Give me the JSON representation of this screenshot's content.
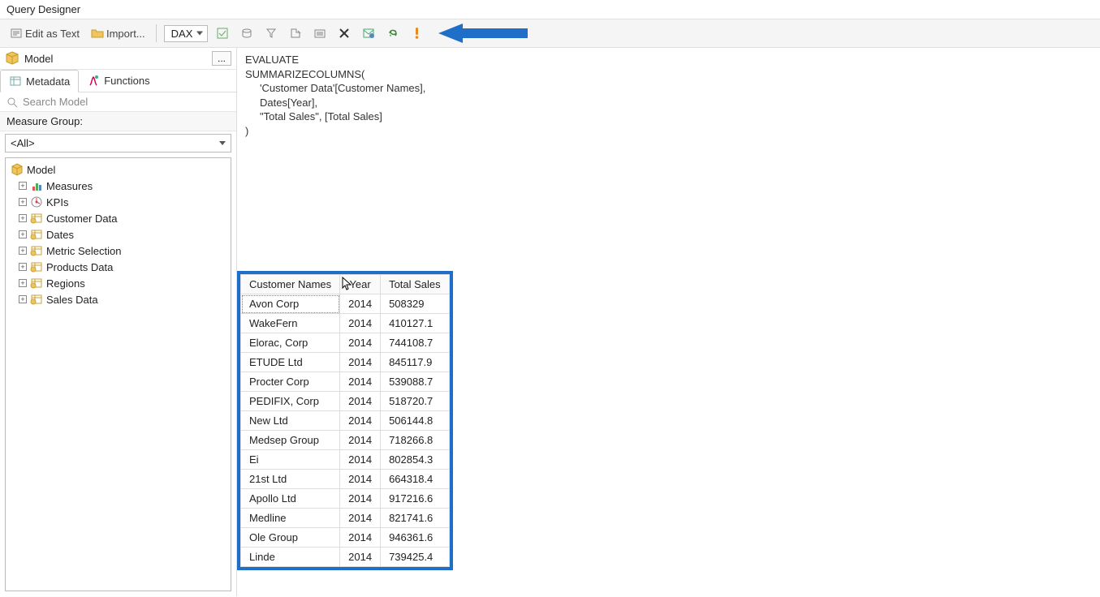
{
  "window": {
    "title": "Query Designer"
  },
  "toolbar": {
    "edit_as_text": "Edit as Text",
    "import": "Import...",
    "language": "DAX"
  },
  "sidebar": {
    "model_label": "Model",
    "ellipsis": "...",
    "tabs": {
      "metadata": "Metadata",
      "functions": "Functions"
    },
    "search_placeholder": "Search Model",
    "measure_group_label": "Measure Group:",
    "measure_group_value": "<All>",
    "tree_root": "Model",
    "tree_items": [
      {
        "label": "Measures",
        "kind": "measures"
      },
      {
        "label": "KPIs",
        "kind": "kpis"
      },
      {
        "label": "Customer Data",
        "kind": "table"
      },
      {
        "label": "Dates",
        "kind": "table"
      },
      {
        "label": "Metric Selection",
        "kind": "table"
      },
      {
        "label": "Products Data",
        "kind": "table"
      },
      {
        "label": "Regions",
        "kind": "table"
      },
      {
        "label": "Sales Data",
        "kind": "table"
      }
    ]
  },
  "query": {
    "line1": "EVALUATE",
    "line2": "SUMMARIZECOLUMNS(",
    "line3": "'Customer Data'[Customer Names],",
    "line4": "Dates[Year],",
    "line5": "\"Total Sales\", [Total Sales]",
    "line6": ")"
  },
  "results": {
    "columns": [
      "Customer Names",
      "Year",
      "Total Sales"
    ],
    "rows": [
      [
        "Avon Corp",
        "2014",
        "508329"
      ],
      [
        "WakeFern",
        "2014",
        "410127.1"
      ],
      [
        "Elorac, Corp",
        "2014",
        "744108.7"
      ],
      [
        "ETUDE Ltd",
        "2014",
        "845117.9"
      ],
      [
        "Procter Corp",
        "2014",
        "539088.7"
      ],
      [
        "PEDIFIX, Corp",
        "2014",
        "518720.7"
      ],
      [
        "New Ltd",
        "2014",
        "506144.8"
      ],
      [
        "Medsep Group",
        "2014",
        "718266.8"
      ],
      [
        "Ei",
        "2014",
        "802854.3"
      ],
      [
        "21st Ltd",
        "2014",
        "664318.4"
      ],
      [
        "Apollo Ltd",
        "2014",
        "917216.6"
      ],
      [
        "Medline",
        "2014",
        "821741.6"
      ],
      [
        "Ole Group",
        "2014",
        "946361.6"
      ],
      [
        "Linde",
        "2014",
        "739425.4"
      ]
    ]
  }
}
